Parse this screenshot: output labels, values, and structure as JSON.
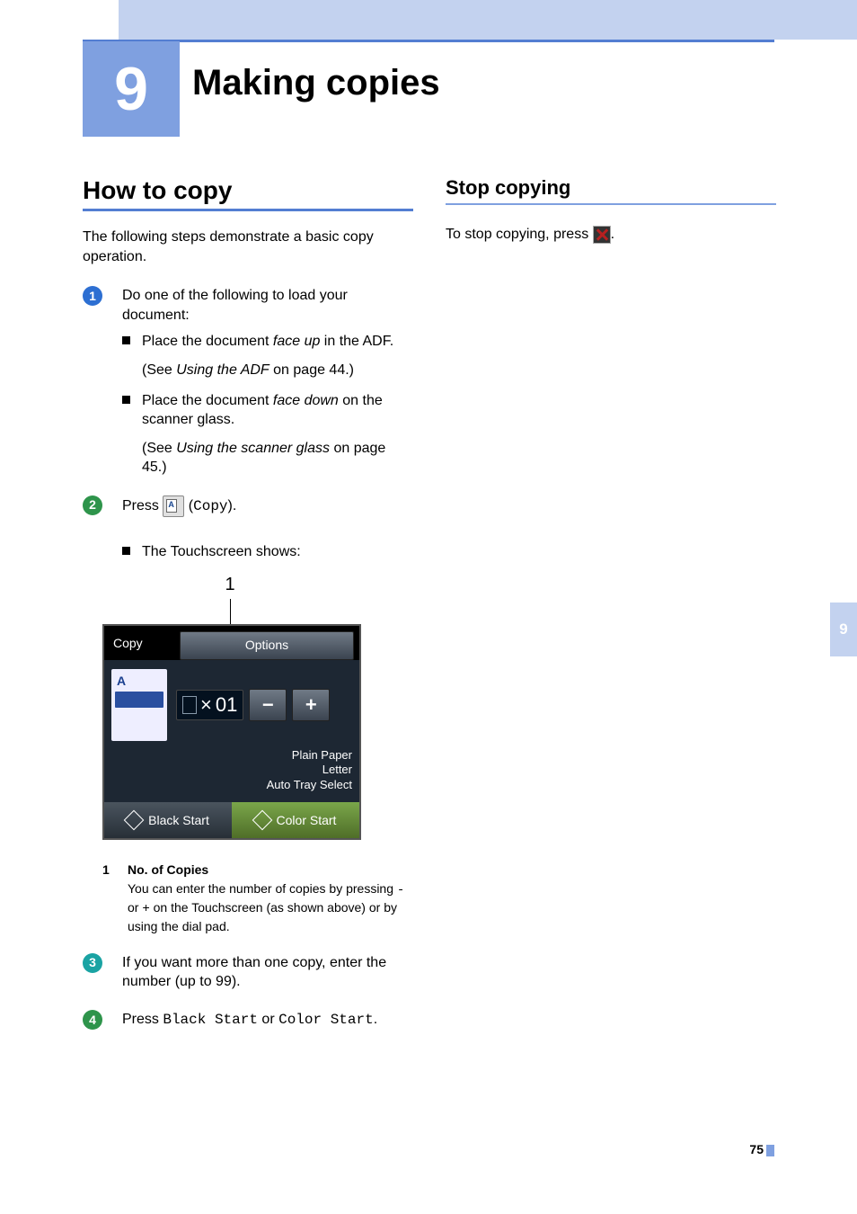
{
  "chapter": {
    "number": "9",
    "title": "Making copies"
  },
  "left": {
    "h1": "How to copy",
    "intro": "The following steps demonstrate a basic copy operation.",
    "step1": {
      "text": "Do one of the following to load your document:",
      "b1_pre": "Place the document ",
      "b1_em": "face up",
      "b1_post": " in the ADF.",
      "b1_see_pre": "(See ",
      "b1_see_em": "Using the ADF",
      "b1_see_post": " on page 44.)",
      "b2_pre": "Place the document ",
      "b2_em": "face down",
      "b2_post": " on the scanner glass.",
      "b2_see_pre": "(See ",
      "b2_see_em": "Using the scanner glass",
      "b2_see_post": " on page 45.)"
    },
    "step2": {
      "pre": "Press ",
      "post_open": " (",
      "mono": "Copy",
      "post_close": ").",
      "sub1": "The Touchscreen shows:"
    },
    "ts_callout": "1",
    "ts": {
      "copy": "Copy",
      "options": "Options",
      "count_prefix": "×",
      "count_value": "01",
      "minus": "−",
      "plus": "+",
      "info1": "Plain Paper",
      "info2": "Letter",
      "info3": "Auto Tray Select",
      "black_start": "Black Start",
      "color_start": "Color Start",
      "preview_letter": "A"
    },
    "legend": {
      "num": "1",
      "title": "No. of Copies",
      "text_pre": "You can enter the number of copies by pressing ",
      "minus": "-",
      "mid": " or ",
      "plus": "+",
      "text_post": " on the Touchscreen (as shown above) or by using the dial pad."
    },
    "step3": "If you want more than one copy, enter the number (up to 99).",
    "step4": {
      "pre": "Press ",
      "mono1": "Black Start",
      "mid": " or ",
      "mono2": "Color Start",
      "post": "."
    }
  },
  "right": {
    "h2": "Stop copying",
    "text_pre": "To stop copying, press ",
    "text_post": "."
  },
  "side_tab": "9",
  "page_number": "75"
}
